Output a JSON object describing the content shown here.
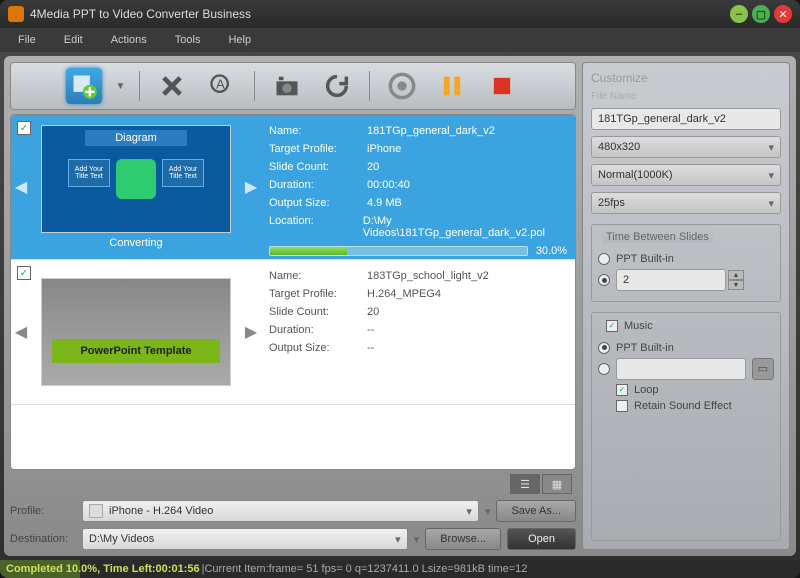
{
  "titlebar": {
    "title": "4Media PPT to Video Converter Business"
  },
  "menu": {
    "file": "File",
    "edit": "Edit",
    "actions": "Actions",
    "tools": "Tools",
    "help": "Help"
  },
  "labels": {
    "name": "Name:",
    "target_profile": "Target Profile:",
    "slide_count": "Slide Count:",
    "duration": "Duration:",
    "output_size": "Output Size:",
    "location": "Location:"
  },
  "item1": {
    "thumb_title": "Diagram",
    "thumb_box": "Add Your Title Text",
    "status": "Converting",
    "name": "181TGp_general_dark_v2",
    "target_profile": "iPhone",
    "slide_count": "20",
    "duration": "00:00:40",
    "output_size": "4.9 MB",
    "location": "D:\\My Videos\\181TGp_general_dark_v2.pol",
    "progress_pct": "30.0%"
  },
  "item2": {
    "thumb_text": "PowerPoint Template",
    "name": "183TGp_school_light_v2",
    "target_profile": "H.264_MPEG4",
    "slide_count": "20",
    "duration": "--",
    "output_size": "--"
  },
  "form": {
    "profile_label": "Profile:",
    "profile_value": "iPhone - H.264 Video",
    "dest_label": "Destination:",
    "dest_value": "D:\\My Videos",
    "save_as": "Save As...",
    "browse": "Browse...",
    "open": "Open"
  },
  "side": {
    "customize": "Customize",
    "file_name_label": "File Name",
    "file_name": "181TGp_general_dark_v2",
    "resolution": "480x320",
    "bitrate": "Normal(1000K)",
    "fps": "25fps",
    "time_between": "Time Between Slides",
    "ppt_builtin": "PPT Built-in",
    "time_value": "2",
    "music": "Music",
    "loop": "Loop",
    "retain": "Retain Sound Effect"
  },
  "status": {
    "completed": "Completed 10.0%, Time Left:00:01:56",
    "current": "|Current Item:frame= 51 fps= 0 q=1237411.0 Lsize=981kB time=12"
  }
}
